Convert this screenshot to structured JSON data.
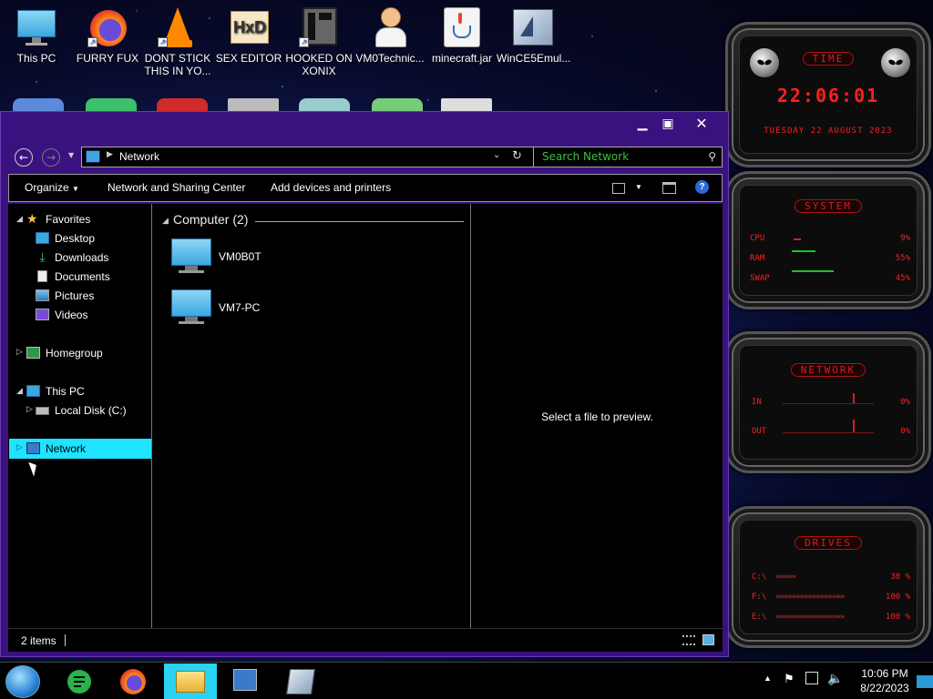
{
  "desktop": {
    "icons": [
      {
        "label": "This PC",
        "icon": "monitor-icon"
      },
      {
        "label": "FURRY FUX",
        "icon": "firefox-icon"
      },
      {
        "label": "DONT STICK THIS IN YO...",
        "icon": "vlc-icon"
      },
      {
        "label": "SEX EDITOR",
        "icon": "hxd-icon"
      },
      {
        "label": "HOOKED ON XONIX",
        "icon": "xonix-icon"
      },
      {
        "label": "VM0Technic...",
        "icon": "doctor-icon"
      },
      {
        "label": "minecraft.jar",
        "icon": "java-icon"
      },
      {
        "label": "WinCE5Emul...",
        "icon": "wince-icon"
      }
    ]
  },
  "explorer": {
    "address": {
      "path": "Network"
    },
    "search": {
      "placeholder": "Search Network"
    },
    "toolbar": {
      "organize": "Organize",
      "network_sharing": "Network and Sharing Center",
      "add_devices": "Add devices and printers"
    },
    "nav": {
      "favorites": "Favorites",
      "desktop": "Desktop",
      "downloads": "Downloads",
      "documents": "Documents",
      "pictures": "Pictures",
      "videos": "Videos",
      "homegroup": "Homegroup",
      "this_pc": "This PC",
      "local_disk": "Local Disk (C:)",
      "network": "Network"
    },
    "group": {
      "name": "Computer (2)"
    },
    "items": [
      "VM0B0T",
      "VM7-PC"
    ],
    "preview_text": "Select a file to preview.",
    "status": {
      "count": "2 items"
    }
  },
  "gadgets": {
    "time": {
      "title": "TIME",
      "clock": "22:06:01",
      "date": "TUESDAY 22 AUGUST 2023"
    },
    "system": {
      "title": "SYSTEM",
      "rows": [
        {
          "label": "CPU",
          "value": "9%",
          "level": 9
        },
        {
          "label": "RAM",
          "value": "55%",
          "level": 55
        },
        {
          "label": "SWAP",
          "value": "45%",
          "level": 45
        }
      ]
    },
    "network": {
      "title": "NETWORK",
      "rows": [
        {
          "label": "IN",
          "value": "0%"
        },
        {
          "label": "OUT",
          "value": "0%"
        }
      ]
    },
    "drives": {
      "title": "DRIVES",
      "rows": [
        {
          "label": "C:\\",
          "value": "38 %",
          "level": 38
        },
        {
          "label": "F:\\",
          "value": "100 %",
          "level": 100
        },
        {
          "label": "E:\\",
          "value": "100 %",
          "level": 100
        }
      ]
    }
  },
  "taskbar": {
    "time": "10:06 PM",
    "date": "8/22/2023"
  },
  "colors": {
    "window_frame": "#3a1280",
    "selection": "#1fe3ff",
    "gadget_red": "#ff1f1f",
    "search_text": "#3dbf3d"
  }
}
